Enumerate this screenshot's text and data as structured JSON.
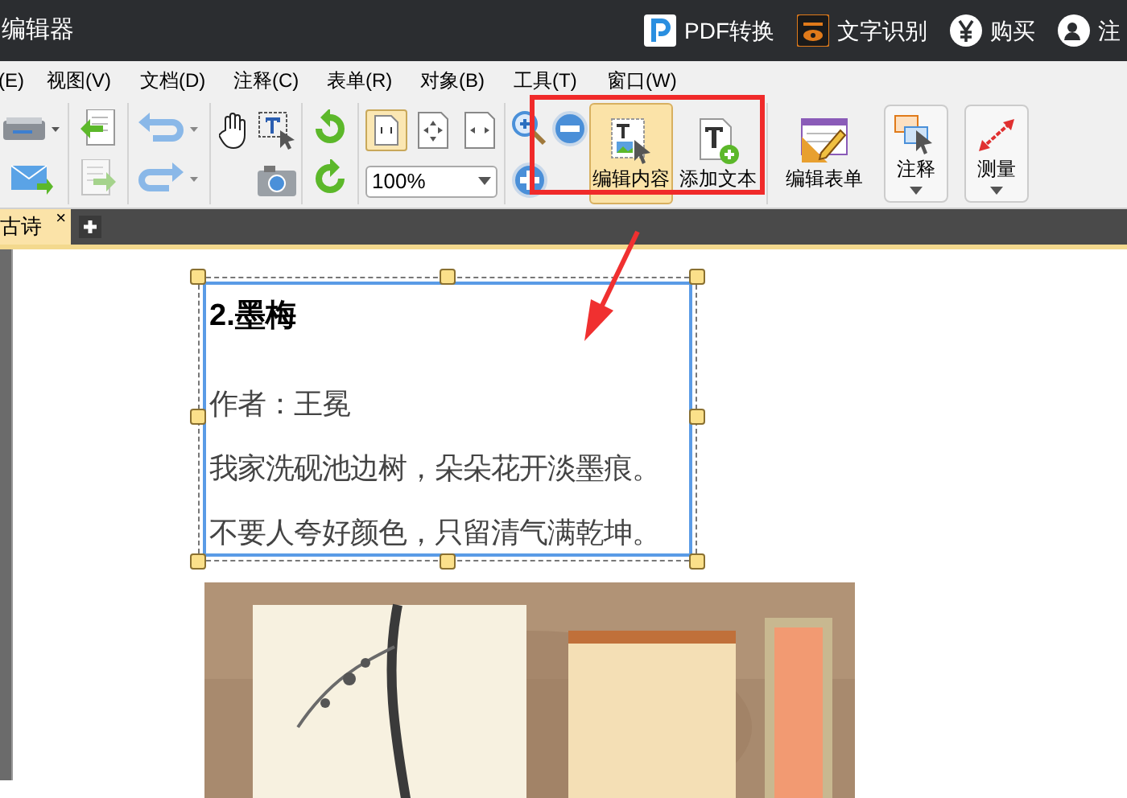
{
  "window": {
    "title": "编辑器"
  },
  "header_links": [
    {
      "label": "PDF转换",
      "kind": "pdf"
    },
    {
      "label": "文字识别",
      "kind": "ocr"
    },
    {
      "label": "购买",
      "kind": "buy"
    },
    {
      "label": "注",
      "kind": "user"
    }
  ],
  "menu": [
    "(E)",
    "视图(V)",
    "文档(D)",
    "注释(C)",
    "表单(R)",
    "对象(B)",
    "工具(T)",
    "窗口(W)"
  ],
  "toolbar": {
    "zoom": "100%",
    "buttons": [
      {
        "label": "编辑内容",
        "kind": "edit",
        "selected": true
      },
      {
        "label": "添加文本",
        "kind": "addtext",
        "selected": false
      },
      {
        "label": "编辑表单",
        "kind": "form",
        "selected": false
      },
      {
        "label": "注释",
        "kind": "comment",
        "selected": false
      },
      {
        "label": "测量",
        "kind": "measure",
        "selected": false
      }
    ]
  },
  "tabs": [
    {
      "label": "古诗",
      "selected": true,
      "close": "×"
    }
  ],
  "document": {
    "heading": "2.墨梅",
    "lines": [
      "作者：王冕",
      "我家洗砚池边树，朵朵花开淡墨痕。",
      "不要人夸好颜色，只留清气满乾坤。"
    ],
    "image": {
      "kind": "picture"
    }
  }
}
